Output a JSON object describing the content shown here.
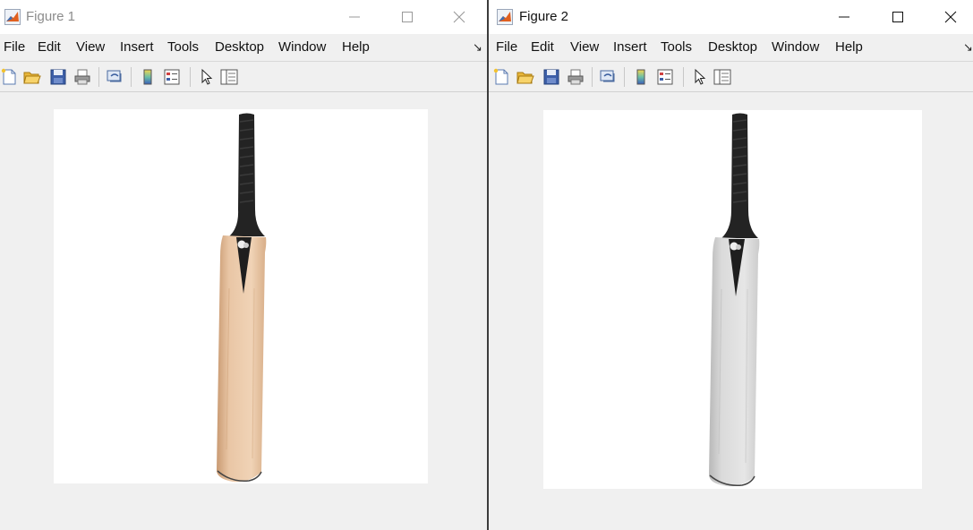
{
  "figure1": {
    "title": "Figure 1",
    "menu": [
      "File",
      "Edit",
      "View",
      "Insert",
      "Tools",
      "Desktop",
      "Window",
      "Help"
    ]
  },
  "figure2": {
    "title": "Figure 2",
    "menu": [
      "File",
      "Edit",
      "View",
      "Insert",
      "Tools",
      "Desktop",
      "Window",
      "Help"
    ]
  },
  "toolbar_icons": [
    "new-figure-icon",
    "open-file-icon",
    "save-icon",
    "print-icon",
    "link-plot-icon",
    "insert-colorbar-icon",
    "insert-legend-icon",
    "edit-plot-arrow-icon",
    "property-inspector-icon"
  ],
  "images": {
    "figure1": "color cricket bat",
    "figure2": "grayscale cricket bat"
  },
  "colors": {
    "bat_wood": "#e8c4a2",
    "bat_wood_shade": "#d4a983",
    "bat_gray": "#dcdcdc",
    "bat_gray_shade": "#c2c2c2",
    "grip": "#222222",
    "window_bg": "#f0f0f0",
    "matlab_orange": "#e06020"
  }
}
